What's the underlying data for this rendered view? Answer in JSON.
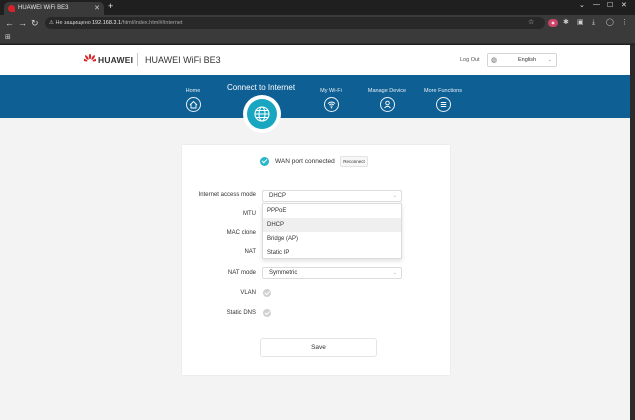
{
  "browser": {
    "tab_title": "HUAWEI WiFi BE3",
    "tab_close": "✕",
    "new_tab": "+",
    "window_controls": [
      "⌄",
      "—",
      "☐",
      "✕"
    ],
    "nav": {
      "back": "←",
      "forward": "→",
      "reload": "↻"
    },
    "security_label": "Не защищено",
    "url_host": "192.168.3.1",
    "url_path": "/html/index.html#/internet",
    "bookmark_icon": "⊞"
  },
  "header": {
    "brand": "HUAWEI",
    "product": "HUAWEI WiFi BE3",
    "logout": "Log Out",
    "language": "English",
    "brand_color": "#d6252a"
  },
  "nav": {
    "band_color": "#0e5f94",
    "accent_color": "#19a6c0",
    "items": [
      {
        "label": "Home",
        "icon": "home-icon"
      },
      {
        "label": "Connect to Internet",
        "icon": "globe-icon"
      },
      {
        "label": "My Wi-Fi",
        "icon": "wifi-icon"
      },
      {
        "label": "Manage Device",
        "icon": "user-icon"
      },
      {
        "label": "More Functions",
        "icon": "menu-icon"
      }
    ]
  },
  "status": {
    "text": "WAN port connected",
    "reconnect": "Reconnect"
  },
  "form": {
    "internet_access_mode": {
      "label": "Internet access mode",
      "value": "DHCP"
    },
    "mtu": {
      "label": "MTU"
    },
    "mac_clone": {
      "label": "MAC clone"
    },
    "nat": {
      "label": "NAT"
    },
    "nat_mode": {
      "label": "NAT mode",
      "value": "Symmetric"
    },
    "vlan": {
      "label": "VLAN"
    },
    "static_dns": {
      "label": "Static DNS"
    },
    "save": "Save",
    "mode_options": [
      "PPPoE",
      "DHCP",
      "Bridge (AP)",
      "Static IP"
    ],
    "selected_option": "DHCP"
  }
}
